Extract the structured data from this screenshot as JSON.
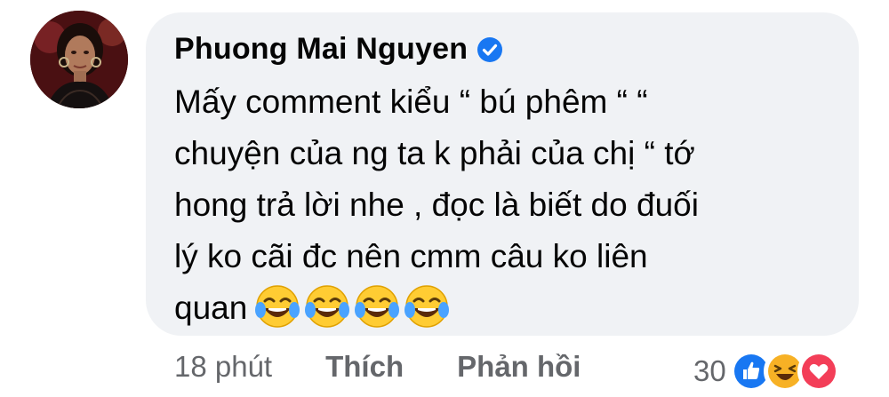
{
  "comment": {
    "author": "Phuong Mai Nguyen",
    "verified_icon": "verified-badge-icon",
    "text_lines": [
      "Mấy comment kiểu “ bú phêm “ “",
      "chuyện của ng ta k phải của chị “ tớ",
      "hong trả lời nhe , đọc là biết do đuối",
      "lý ko cãi đc nên cmm câu ko liên",
      "quan"
    ],
    "emojis": [
      "tears-of-joy-icon",
      "tears-of-joy-icon",
      "tears-of-joy-icon",
      "tears-of-joy-icon"
    ]
  },
  "actions": {
    "time": "18 phút",
    "like_label": "Thích",
    "reply_label": "Phản hồi"
  },
  "reactions": {
    "count": "30",
    "icons": [
      "like-reaction-icon",
      "haha-reaction-icon",
      "love-reaction-icon"
    ]
  },
  "colors": {
    "bubble": "#f0f2f5",
    "text": "#050505",
    "muted": "#65676b",
    "verified": "#1877f2",
    "like": "#1877f2",
    "love": "#f33e58",
    "haha": "#f7b125"
  }
}
